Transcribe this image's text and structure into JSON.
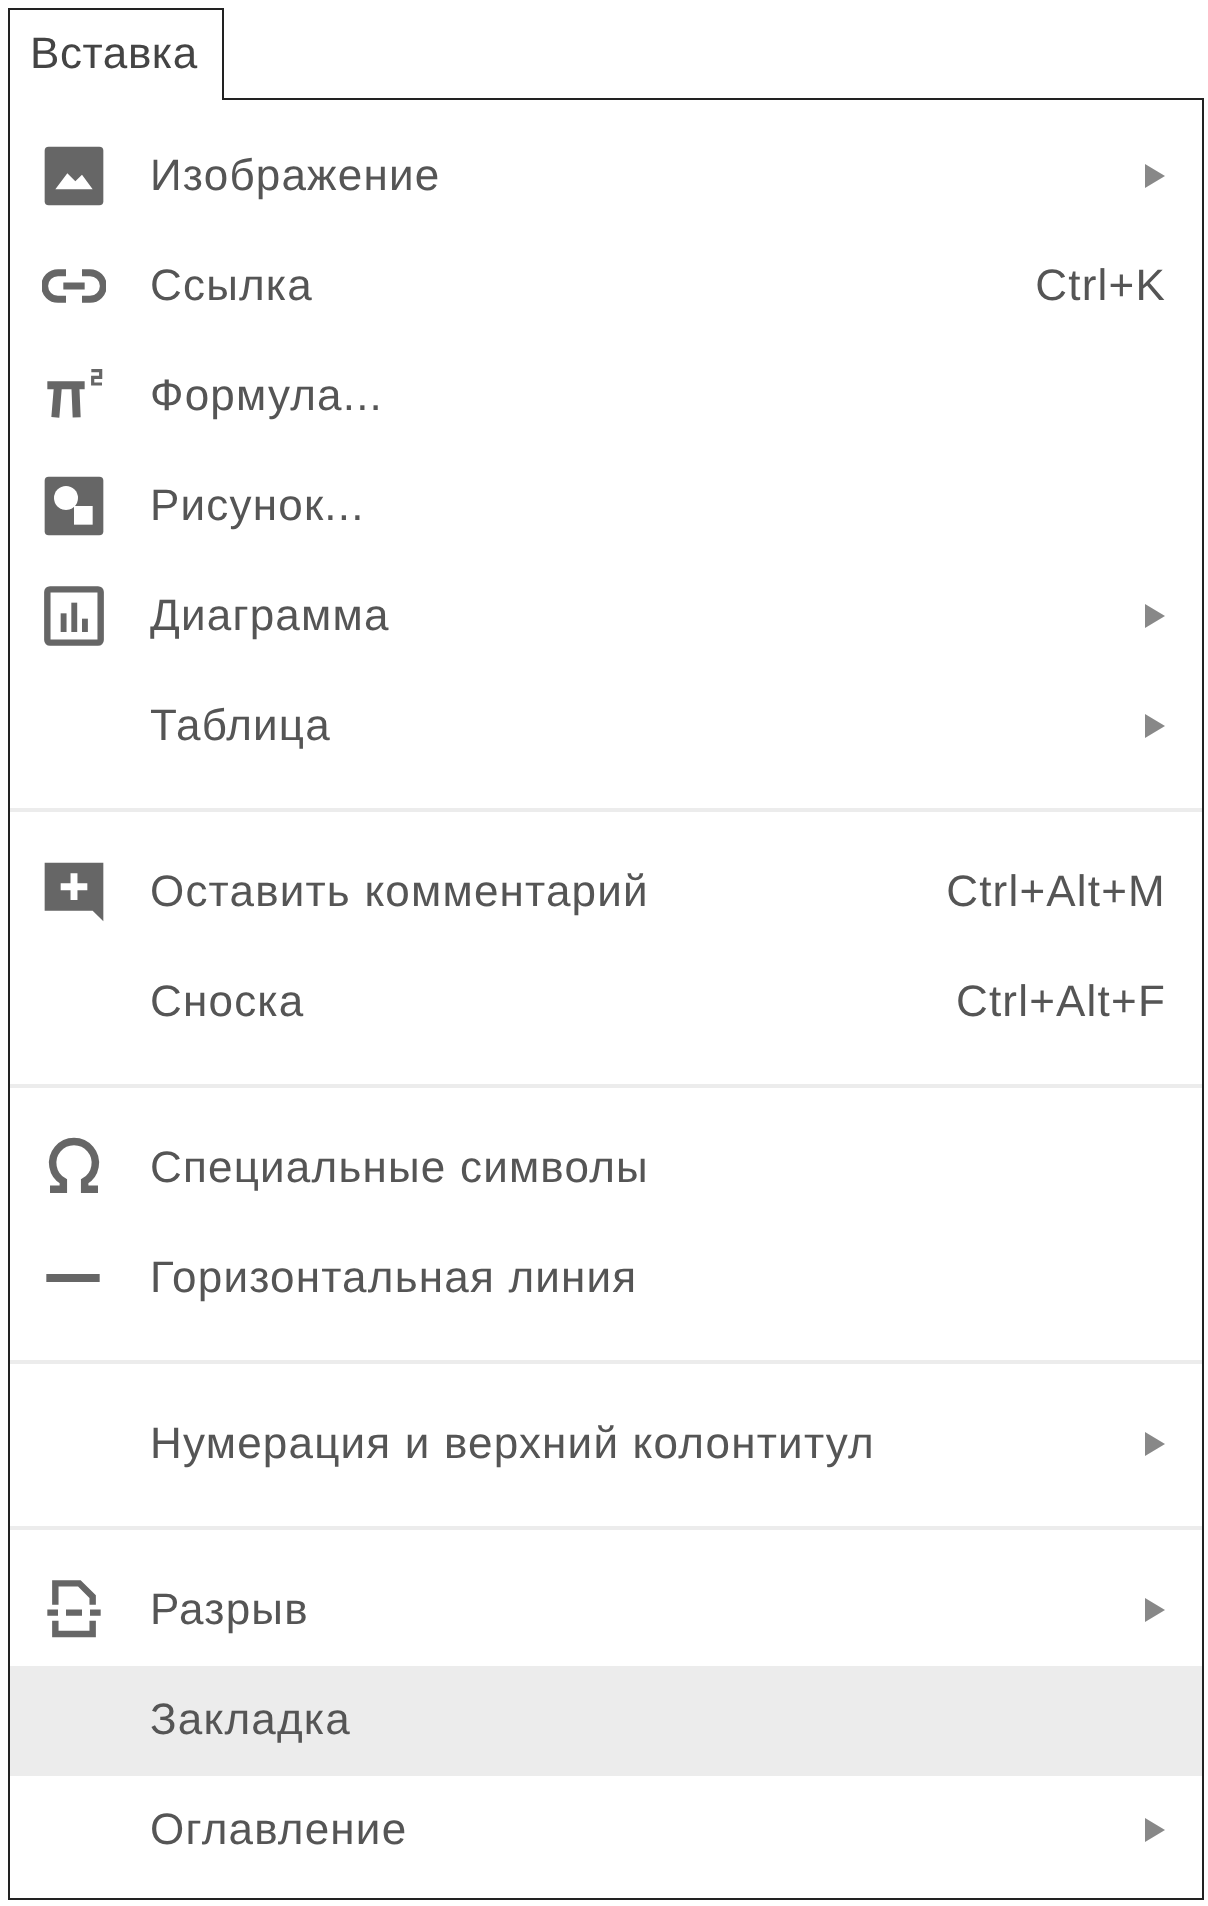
{
  "tab": {
    "label": "Вставка"
  },
  "menu": {
    "sections": [
      [
        {
          "label": "Изображение",
          "submenu": true,
          "selected": false
        },
        {
          "label": "Ссылка",
          "shortcut": "Ctrl+K",
          "submenu": false,
          "selected": false
        },
        {
          "label": "Формула...",
          "submenu": false,
          "selected": false
        },
        {
          "label": "Рисунок...",
          "submenu": false,
          "selected": false
        },
        {
          "label": "Диаграмма",
          "submenu": true,
          "selected": false
        },
        {
          "label": "Таблица",
          "submenu": true,
          "selected": false
        }
      ],
      [
        {
          "label": "Оставить комментарий",
          "shortcut": "Ctrl+Alt+M",
          "submenu": false,
          "selected": false
        },
        {
          "label": "Сноска",
          "shortcut": "Ctrl+Alt+F",
          "submenu": false,
          "selected": false
        }
      ],
      [
        {
          "label": "Специальные символы",
          "submenu": false,
          "selected": false
        },
        {
          "label": "Горизонтальная линия",
          "submenu": false,
          "selected": false
        }
      ],
      [
        {
          "label": "Нумерация и верхний колонтитул",
          "submenu": true,
          "selected": false
        }
      ],
      [
        {
          "label": "Разрыв",
          "submenu": true,
          "selected": false
        },
        {
          "label": "Закладка",
          "submenu": false,
          "selected": true
        },
        {
          "label": "Оглавление",
          "submenu": true,
          "selected": false
        }
      ]
    ]
  }
}
